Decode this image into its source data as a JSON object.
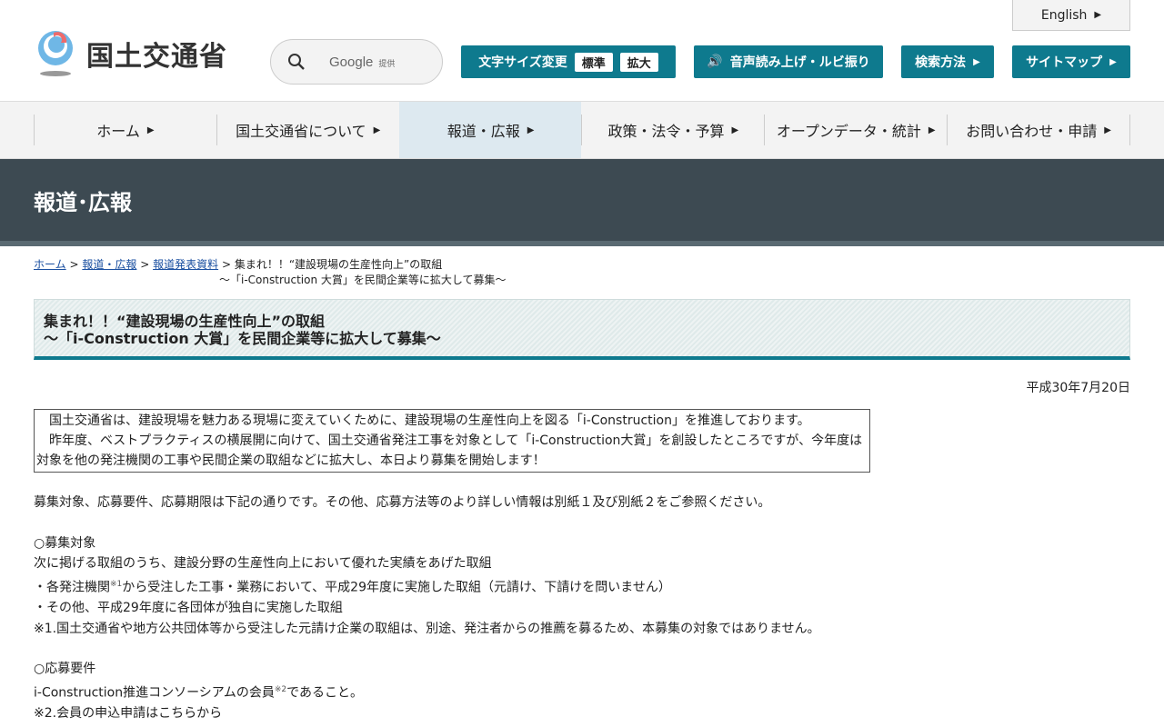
{
  "header": {
    "logo_text": "国土交通省",
    "search_brand": "Google",
    "search_provided": "提供",
    "english": "English",
    "text_size_label": "文字サイズ変更",
    "size_standard": "標準",
    "size_large": "拡大",
    "voice_label": "音声読み上げ・ルビ振り",
    "search_method": "検索方法",
    "sitemap": "サイトマップ"
  },
  "nav": [
    "ホーム",
    "国土交通省について",
    "報道・広報",
    "政策・法令・予算",
    "オープンデータ・統計",
    "お問い合わせ・申請"
  ],
  "banner": "報道･広報",
  "breadcrumb": {
    "home": "ホーム",
    "sep": ">",
    "press": "報道・広報",
    "releases": "報道発表資料",
    "current1": "集まれ！！“建設現場の生産性向上”の取組",
    "current2": "～「i-Construction 大賞」を民間企業等に拡大して募集～"
  },
  "title": {
    "line1": "集まれ！！“建設現場の生産性向上”の取組",
    "line2": "～「i-Construction 大賞」を民間企業等に拡大して募集～"
  },
  "date": "平成30年7月20日",
  "summary": [
    "　国土交通省は、建設現場を魅力ある現場に変えていくために、建設現場の生産性向上を図る「i-Construction」を推進しております。",
    "　昨年度、ベストプラクティスの横展開に向けて、国土交通省発注工事を対象として「i-Construction大賞」を創設したところですが、今年度は対象を他の発注機関の工事や民間企業の取組などに拡大し、本日より募集を開始します！"
  ],
  "intro": "募集対象、応募要件、応募期限は下記の通りです。その他、応募方法等のより詳しい情報は別紙１及び別紙２をご参照ください。",
  "target": {
    "heading": "○募集対象",
    "l1": "次に掲げる取組のうち、建設分野の生産性向上において優れた実績をあげた取組",
    "l2a": "・各発注機関",
    "l2sup": "※1",
    "l2b": "から受注した工事・業務において、平成29年度に実施した取組（元請け、下請けを問いません）",
    "l3": "・その他、平成29年度に各団体が独自に実施した取組",
    "l4": "※1.国土交通省や地方公共団体等から受注した元請け企業の取組は、別途、発注者からの推薦を募るため、本募集の対象ではありません。"
  },
  "req": {
    "heading": "○応募要件",
    "l1a": "i-Construction推進コンソーシアムの会員",
    "l1sup": "※2",
    "l1b": "であること。",
    "l2": "※2.会員の申込申請はこちらから"
  }
}
